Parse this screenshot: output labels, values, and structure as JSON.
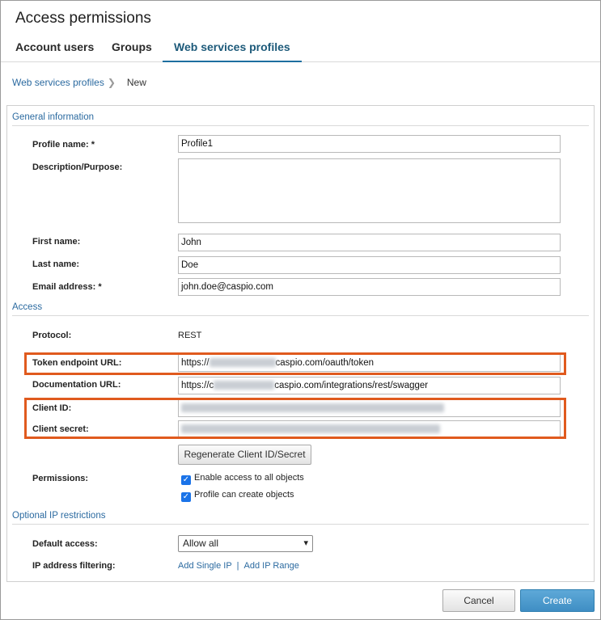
{
  "title": "Access permissions",
  "tabs": [
    "Account users",
    "Groups",
    "Web services profiles"
  ],
  "breadcrumb": {
    "parent": "Web services profiles",
    "current": "New"
  },
  "sections": {
    "general": "General information",
    "access": "Access",
    "ip": "Optional IP restrictions"
  },
  "fields": {
    "profile_name": {
      "label": "Profile name: *",
      "value": "Profile1"
    },
    "description": {
      "label": "Description/Purpose:",
      "value": ""
    },
    "first_name": {
      "label": "First name:",
      "value": "John"
    },
    "last_name": {
      "label": "Last name:",
      "value": "Doe"
    },
    "email": {
      "label": "Email address: *",
      "value": "john.doe@caspio.com"
    },
    "protocol": {
      "label": "Protocol:",
      "value": "REST"
    },
    "token_url": {
      "label": "Token endpoint URL:",
      "prefix": "https://",
      "suffix": "caspio.com/oauth/token"
    },
    "doc_url": {
      "label": "Documentation URL:",
      "prefix": "https://c",
      "suffix": "caspio.com/integrations/rest/swagger"
    },
    "client_id": {
      "label": "Client ID:"
    },
    "client_secret": {
      "label": "Client secret:"
    }
  },
  "regenerate_button": "Regenerate Client ID/Secret",
  "permissions": {
    "label": "Permissions:",
    "options": [
      "Enable access to all objects",
      "Profile can create objects"
    ]
  },
  "ip": {
    "default_label": "Default access:",
    "default_value": "Allow all",
    "filter_label": "IP address filtering:",
    "add_single": "Add Single IP",
    "separator": "|",
    "add_range": "Add IP Range"
  },
  "footer": {
    "cancel": "Cancel",
    "create": "Create"
  },
  "colors": {
    "accent": "#2b6aa0",
    "highlight": "#e05a1e",
    "primary_button": "#3f8ec4"
  },
  "icons": {
    "checkbox": "checkmark-icon",
    "dropdown": "chevron-down-icon",
    "breadcrumb": "chevron-right-icon"
  }
}
